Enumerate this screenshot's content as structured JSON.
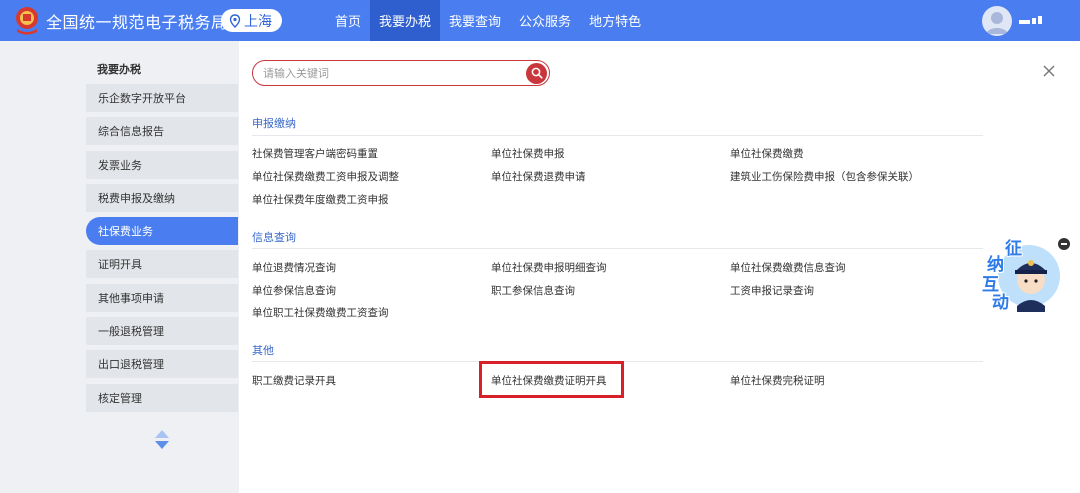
{
  "header": {
    "site_title": "全国统一规范电子税务局",
    "region": "上海",
    "nav": [
      "首页",
      "我要办税",
      "我要查询",
      "公众服务",
      "地方特色"
    ],
    "active_nav_index": 1
  },
  "sidebar": {
    "title": "我要办税",
    "items": [
      "乐企数字开放平台",
      "综合信息报告",
      "发票业务",
      "税费申报及缴纳",
      "社保费业务",
      "证明开具",
      "其他事项申请",
      "一般退税管理",
      "出口退税管理",
      "核定管理"
    ],
    "active_index": 4
  },
  "search": {
    "placeholder": "请输入关键词",
    "value": ""
  },
  "sections": [
    {
      "title": "申报缴纳",
      "links": [
        "社保费管理客户端密码重置",
        "单位社保费申报",
        "单位社保费缴费",
        "单位社保费缴费工资申报及调整",
        "单位社保费退费申请",
        "建筑业工伤保险费申报（包含参保关联）",
        "单位社保费年度缴费工资申报"
      ]
    },
    {
      "title": "信息查询",
      "links": [
        "单位退费情况查询",
        "单位社保费申报明细查询",
        "单位社保费缴费信息查询",
        "单位参保信息查询",
        "职工参保信息查询",
        "工资申报记录查询",
        "单位职工社保费缴费工资查询"
      ]
    },
    {
      "title": "其他",
      "links": [
        "职工缴费记录开具",
        "单位社保费缴费证明开具",
        "单位社保费完税证明"
      ]
    }
  ],
  "assistant": {
    "chars": [
      "征",
      "纳",
      "互",
      "动"
    ]
  },
  "colors": {
    "header_bg": "#4a7ef0",
    "active_nav_bg": "#2f5fcf",
    "accent_red": "#c9373d",
    "section_title": "#3a68c9"
  }
}
